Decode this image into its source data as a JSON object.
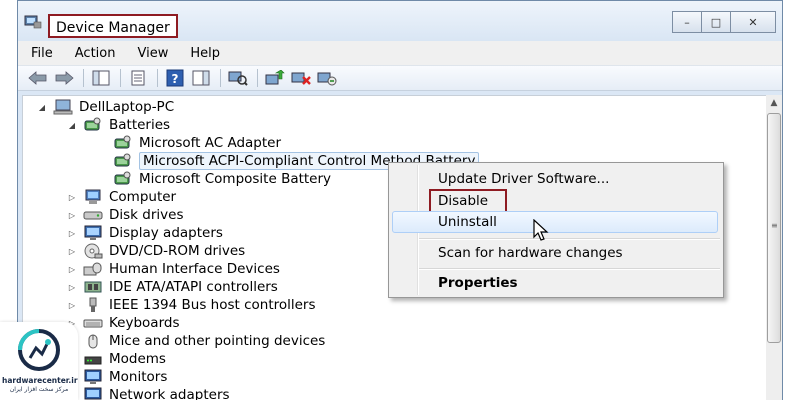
{
  "window": {
    "title": "Device Manager",
    "buttons": {
      "minimize": "–",
      "maximize": "□",
      "close": "✕"
    }
  },
  "menu": [
    "File",
    "Action",
    "View",
    "Help"
  ],
  "toolbar": {
    "icons": [
      "back-arrow-icon",
      "forward-arrow-icon",
      "show-hide-console-tree-icon",
      "properties-icon",
      "help-icon",
      "action-pane-icon",
      "scan-hardware-icon",
      "update-driver-icon",
      "disable-device-icon",
      "uninstall-device-icon"
    ]
  },
  "tree": {
    "root": "DellLaptop-PC",
    "batteries": {
      "label": "Batteries",
      "children": [
        "Microsoft AC Adapter",
        "Microsoft ACPI-Compliant Control Method Battery",
        "Microsoft Composite Battery"
      ]
    },
    "categories": [
      "Computer",
      "Disk drives",
      "Display adapters",
      "DVD/CD-ROM drives",
      "Human Interface Devices",
      "IDE ATA/ATAPI controllers",
      "IEEE 1394 Bus host controllers",
      "Keyboards",
      "Mice and other pointing devices",
      "Modems",
      "Monitors",
      "Network adapters"
    ]
  },
  "context_menu": {
    "update": "Update Driver Software...",
    "disable": "Disable",
    "uninstall": "Uninstall",
    "scan": "Scan for hardware changes",
    "properties": "Properties"
  },
  "logo": {
    "site": "hardwarecenter.ir",
    "tagline": "مرکز سخت افزار ایران"
  },
  "colors": {
    "highlight_border": "#8e1b22",
    "selection": "#eef5fc"
  }
}
